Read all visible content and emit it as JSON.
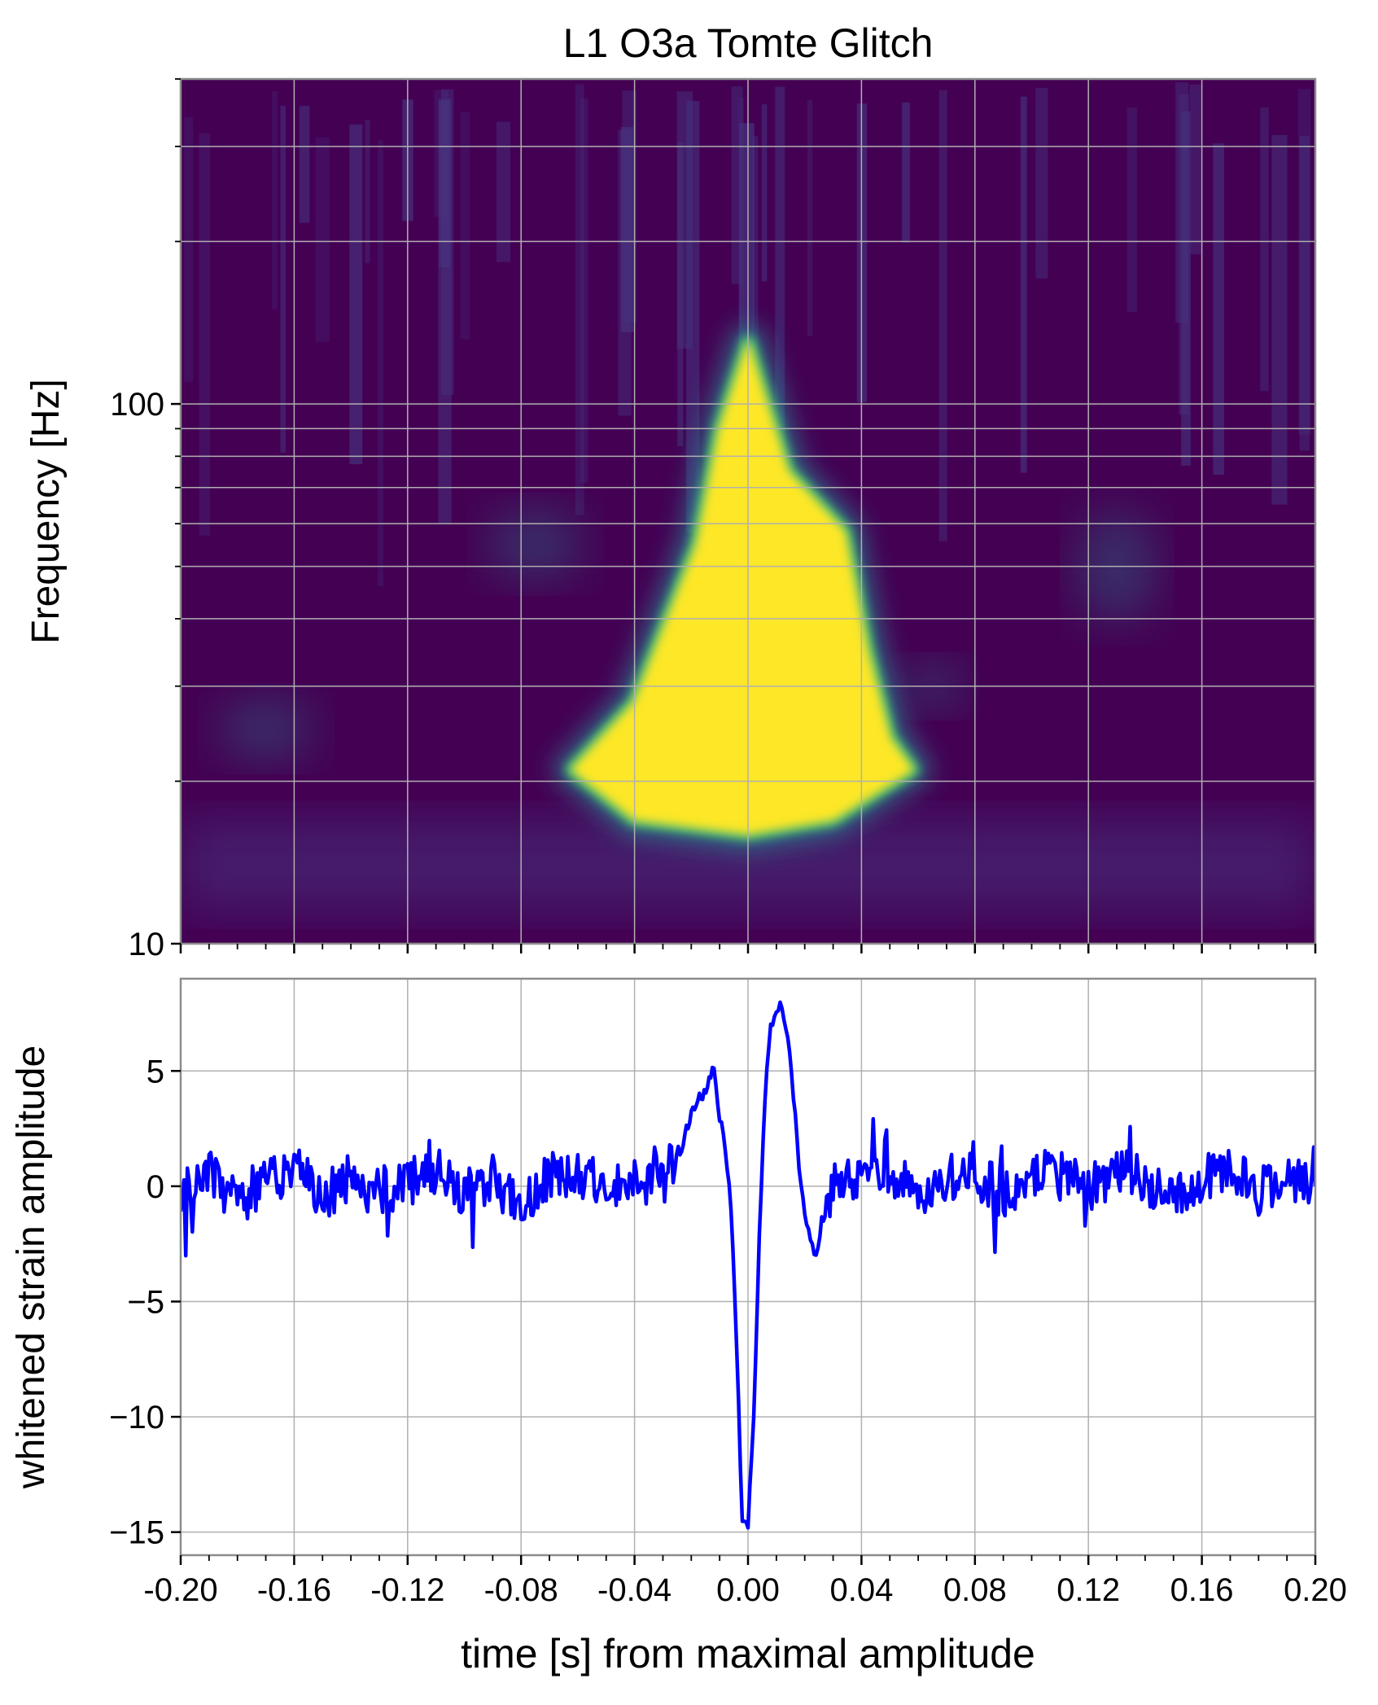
{
  "chart_data": [
    {
      "type": "heatmap",
      "title": "L1 O3a Tomte Glitch",
      "ylabel": "Frequency [Hz]",
      "xlabel": "",
      "yscale": "log",
      "xlim": [
        -0.2,
        0.2
      ],
      "ylim": [
        10,
        400
      ],
      "yticks": [
        {
          "value": 10,
          "label": "10"
        },
        {
          "value": 100,
          "label": "100"
        }
      ],
      "grid": true,
      "colormap": "viridis",
      "colors": {
        "background": "#440154",
        "low": "#46337e",
        "mid": "#277f8e",
        "high": "#fde725"
      },
      "blob": {
        "description_points": [
          {
            "t": -0.062,
            "f": 21
          },
          {
            "t": -0.04,
            "f": 28
          },
          {
            "t": -0.018,
            "f": 55
          },
          {
            "t": -0.01,
            "f": 90
          },
          {
            "t": 0.0,
            "f": 130
          },
          {
            "t": 0.014,
            "f": 75
          },
          {
            "t": 0.034,
            "f": 58
          },
          {
            "t": 0.042,
            "f": 35
          },
          {
            "t": 0.05,
            "f": 24
          },
          {
            "t": 0.058,
            "f": 21
          },
          {
            "t": 0.03,
            "f": 17
          },
          {
            "t": 0.0,
            "f": 16
          },
          {
            "t": -0.04,
            "f": 17
          }
        ]
      }
    },
    {
      "type": "line",
      "ylabel": "whitened strain amplitude",
      "xlabel": "time [s] from maximal amplitude",
      "xlim": [
        -0.2,
        0.2
      ],
      "ylim": [
        -16,
        9
      ],
      "xticks": [
        "-0.20",
        "-0.16",
        "-0.12",
        "-0.08",
        "-0.04",
        "0.00",
        "0.04",
        "0.08",
        "0.12",
        "0.16",
        "0.20"
      ],
      "yticks": [
        {
          "value": 5,
          "label": "5"
        },
        {
          "value": 0,
          "label": "0"
        },
        {
          "value": -5,
          "label": "−5"
        },
        {
          "value": -10,
          "label": "−10"
        },
        {
          "value": -15,
          "label": "−15"
        }
      ],
      "grid": true,
      "series": [
        {
          "color": "#0000ff",
          "x": [
            -0.2,
            -0.19,
            -0.18,
            -0.17,
            -0.16,
            -0.15,
            -0.14,
            -0.13,
            -0.12,
            -0.11,
            -0.1,
            -0.09,
            -0.08,
            -0.07,
            -0.06,
            -0.05,
            -0.04,
            -0.03,
            -0.024,
            -0.02,
            -0.016,
            -0.012,
            -0.01,
            -0.008,
            -0.006,
            -0.004,
            -0.002,
            0.0,
            0.002,
            0.004,
            0.006,
            0.008,
            0.01,
            0.012,
            0.014,
            0.016,
            0.018,
            0.02,
            0.022,
            0.024,
            0.026,
            0.03,
            0.04,
            0.05,
            0.06,
            0.07,
            0.08,
            0.09,
            0.1,
            0.11,
            0.12,
            0.13,
            0.14,
            0.15,
            0.16,
            0.17,
            0.18,
            0.19,
            0.2
          ],
          "y": [
            0.0,
            0.5,
            -0.8,
            0.3,
            0.8,
            -0.5,
            0.4,
            -0.3,
            0.2,
            0.6,
            -0.4,
            0.3,
            -0.8,
            0.5,
            0.7,
            -0.2,
            0.4,
            0.2,
            1.5,
            3.2,
            4.0,
            5.0,
            3.0,
            1.5,
            -1.0,
            -7.0,
            -14.5,
            -14.8,
            -10.0,
            -2.0,
            4.0,
            7.0,
            7.8,
            8.0,
            6.5,
            4.0,
            1.0,
            -1.0,
            -2.5,
            -3.0,
            -2.0,
            0.5,
            0.3,
            0.5,
            -0.2,
            0.4,
            0.6,
            -0.3,
            0.5,
            0.4,
            -0.2,
            0.6,
            0.3,
            -0.4,
            0.4,
            0.7,
            -0.3,
            0.2,
            0.0
          ]
        }
      ]
    }
  ]
}
